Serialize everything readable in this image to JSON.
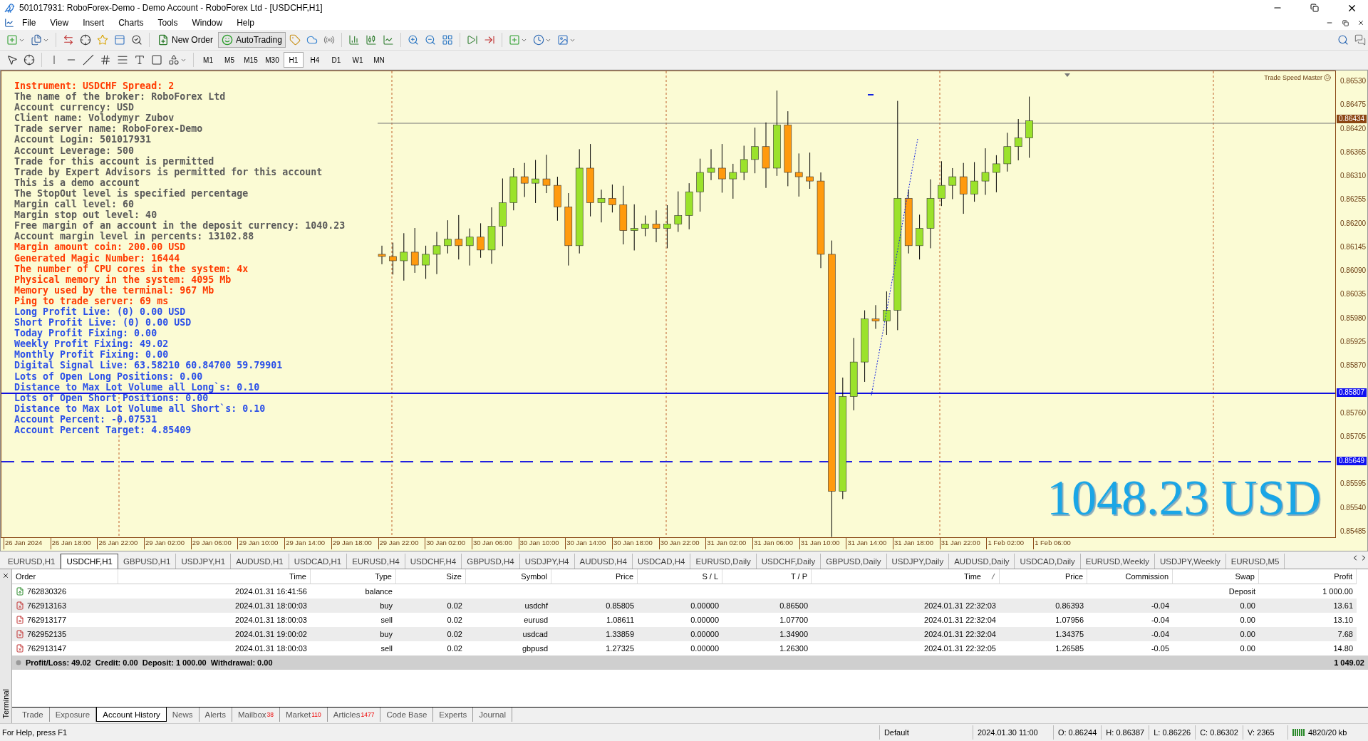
{
  "window": {
    "title": "501017931: RoboForex-Demo - Demo Account - RoboForex Ltd - [USDCHF,H1]"
  },
  "menu": [
    "File",
    "View",
    "Insert",
    "Charts",
    "Tools",
    "Window",
    "Help"
  ],
  "toolbar_buttons": [
    {
      "label": "New Order",
      "on": false
    },
    {
      "label": "AutoTrading",
      "on": true
    }
  ],
  "timeframes": [
    {
      "label": "M1",
      "selected": false
    },
    {
      "label": "M5",
      "selected": false
    },
    {
      "label": "M15",
      "selected": false
    },
    {
      "label": "M30",
      "selected": false
    },
    {
      "label": "H1",
      "selected": true
    },
    {
      "label": "H4",
      "selected": false
    },
    {
      "label": "D1",
      "selected": false
    },
    {
      "label": "W1",
      "selected": false
    },
    {
      "label": "MN",
      "selected": false
    }
  ],
  "chart": {
    "info_lines": [
      {
        "text": "Instrument: USDCHF Spread: 2",
        "kind": "alert"
      },
      {
        "text": "The name of the broker: RoboForex Ltd",
        "kind": "plain"
      },
      {
        "text": "Account currency: USD",
        "kind": "plain"
      },
      {
        "text": "Client name: Volodymyr Zubov",
        "kind": "plain"
      },
      {
        "text": "Trade server name: RoboForex-Demo",
        "kind": "plain"
      },
      {
        "text": "Account Login: 501017931",
        "kind": "plain"
      },
      {
        "text": "Account Leverage: 500",
        "kind": "plain"
      },
      {
        "text": "Trade for this account is permitted",
        "kind": "plain"
      },
      {
        "text": "Trade by Expert Advisors is permitted for this account",
        "kind": "plain"
      },
      {
        "text": "This is a demo account",
        "kind": "plain"
      },
      {
        "text": "The StopOut level is specified percentage",
        "kind": "plain"
      },
      {
        "text": "Margin call level: 60",
        "kind": "plain"
      },
      {
        "text": "Margin stop out level: 40",
        "kind": "plain"
      },
      {
        "text": "Free margin of an account in the deposit currency: 1040.23",
        "kind": "plain"
      },
      {
        "text": "Account margin level in percents: 13102.88",
        "kind": "plain"
      },
      {
        "text": "Margin amount coin: 200.00 USD",
        "kind": "alert"
      },
      {
        "text": "Generated Magic Number: 16444",
        "kind": "alert"
      },
      {
        "text": "The number of CPU cores in the system: 4x",
        "kind": "alert"
      },
      {
        "text": "Physical memory in the system: 4095 Mb",
        "kind": "alert"
      },
      {
        "text": "Memory used by the terminal: 967 Mb",
        "kind": "alert"
      },
      {
        "text": "Ping to trade server: 69 ms",
        "kind": "alert"
      },
      {
        "text": "Long Profit Live: (0) 0.00 USD",
        "kind": "live"
      },
      {
        "text": "Short Profit Live: (0) 0.00 USD",
        "kind": "live"
      },
      {
        "text": "Today Profit Fixing: 0.00",
        "kind": "live"
      },
      {
        "text": "Weekly Profit Fixing: 49.02",
        "kind": "live"
      },
      {
        "text": "Monthly Profit Fixing: 0.00",
        "kind": "live"
      },
      {
        "text": "Digital Signal Live: 63.58210 60.84700 59.79901",
        "kind": "live"
      },
      {
        "text": "Lots of Open Long Positions: 0.00",
        "kind": "live"
      },
      {
        "text": "Distance to Max Lot Volume all Long`s: 0.10",
        "kind": "live"
      },
      {
        "text": "Lots of Open Short Positions: 0.00",
        "kind": "live"
      },
      {
        "text": "Distance to Max Lot Volume all Short`s: 0.10",
        "kind": "live"
      },
      {
        "text": "Account Percent: -0.07531",
        "kind": "live"
      },
      {
        "text": "Account Percent Target: 4.85409",
        "kind": "live"
      }
    ],
    "indicator_label": "Trade Speed Master",
    "price_axis": [
      "0.86530",
      "0.86475",
      "0.86420",
      "0.86365",
      "0.86310",
      "0.86255",
      "0.86200",
      "0.86145",
      "0.86090",
      "0.86035",
      "0.85980",
      "0.85925",
      "0.85870",
      "0.85760",
      "0.85705",
      "0.85595",
      "0.85540",
      "0.85485"
    ],
    "price_tags": [
      {
        "label": "0.86434",
        "kind": "bid"
      },
      {
        "label": "0.85807",
        "kind": "solid"
      },
      {
        "label": "0.85649",
        "kind": "dashed"
      }
    ],
    "time_axis": [
      "26 Jan 2024",
      "26 Jan 18:00",
      "26 Jan 22:00",
      "29 Jan 02:00",
      "29 Jan 06:00",
      "29 Jan 10:00",
      "29 Jan 14:00",
      "29 Jan 18:00",
      "29 Jan 22:00",
      "30 Jan 02:00",
      "30 Jan 06:00",
      "30 Jan 10:00",
      "30 Jan 14:00",
      "30 Jan 18:00",
      "30 Jan 22:00",
      "31 Jan 02:00",
      "31 Jan 06:00",
      "31 Jan 10:00",
      "31 Jan 14:00",
      "31 Jan 18:00",
      "31 Jan 22:00",
      "1 Feb 02:00",
      "1 Feb 06:00"
    ],
    "balance_display": "1048.23 USD"
  },
  "chart_tabs": [
    {
      "label": "EURUSD,H1",
      "selected": false
    },
    {
      "label": "USDCHF,H1",
      "selected": true
    },
    {
      "label": "GBPUSD,H1",
      "selected": false
    },
    {
      "label": "USDJPY,H1",
      "selected": false
    },
    {
      "label": "AUDUSD,H1",
      "selected": false
    },
    {
      "label": "USDCAD,H1",
      "selected": false
    },
    {
      "label": "EURUSD,H4",
      "selected": false
    },
    {
      "label": "USDCHF,H4",
      "selected": false
    },
    {
      "label": "GBPUSD,H4",
      "selected": false
    },
    {
      "label": "USDJPY,H4",
      "selected": false
    },
    {
      "label": "AUDUSD,H4",
      "selected": false
    },
    {
      "label": "USDCAD,H4",
      "selected": false
    },
    {
      "label": "EURUSD,Daily",
      "selected": false
    },
    {
      "label": "USDCHF,Daily",
      "selected": false
    },
    {
      "label": "GBPUSD,Daily",
      "selected": false
    },
    {
      "label": "USDJPY,Daily",
      "selected": false
    },
    {
      "label": "AUDUSD,Daily",
      "selected": false
    },
    {
      "label": "USDCAD,Daily",
      "selected": false
    },
    {
      "label": "EURUSD,Weekly",
      "selected": false
    },
    {
      "label": "USDJPY,Weekly",
      "selected": false
    },
    {
      "label": "EURUSD,M5",
      "selected": false
    }
  ],
  "terminal": {
    "title": "Terminal",
    "columns": [
      "Order",
      "Time",
      "Type",
      "Size",
      "Symbol",
      "Price",
      "S / L",
      "T / P",
      "Time",
      "Price",
      "Commission",
      "Swap",
      "Profit"
    ],
    "rows": [
      {
        "kind": "balance",
        "order": "762830326",
        "time": "2024.01.31 16:41:56",
        "type": "balance",
        "comment": "Deposit",
        "profit": "1 000.00"
      },
      {
        "kind": "trade",
        "order": "762913163",
        "time": "2024.01.31 18:00:03",
        "type": "buy",
        "size": "0.02",
        "symbol": "usdchf",
        "price": "0.85805",
        "sl": "0.00000",
        "tp": "0.86500",
        "close_time": "2024.01.31 22:32:03",
        "close_price": "0.86393",
        "commission": "-0.04",
        "swap": "0.00",
        "profit": "13.61"
      },
      {
        "kind": "trade",
        "order": "762913177",
        "time": "2024.01.31 18:00:03",
        "type": "sell",
        "size": "0.02",
        "symbol": "eurusd",
        "price": "1.08611",
        "sl": "0.00000",
        "tp": "1.07700",
        "close_time": "2024.01.31 22:32:04",
        "close_price": "1.07956",
        "commission": "-0.04",
        "swap": "0.00",
        "profit": "13.10"
      },
      {
        "kind": "trade",
        "order": "762952135",
        "time": "2024.01.31 19:00:02",
        "type": "buy",
        "size": "0.02",
        "symbol": "usdcad",
        "price": "1.33859",
        "sl": "0.00000",
        "tp": "1.34900",
        "close_time": "2024.01.31 22:32:04",
        "close_price": "1.34375",
        "commission": "-0.04",
        "swap": "0.00",
        "profit": "7.68"
      },
      {
        "kind": "trade",
        "order": "762913147",
        "time": "2024.01.31 18:00:03",
        "type": "sell",
        "size": "0.02",
        "symbol": "gbpusd",
        "price": "1.27325",
        "sl": "0.00000",
        "tp": "1.26300",
        "close_time": "2024.01.31 22:32:05",
        "close_price": "1.26585",
        "commission": "-0.05",
        "swap": "0.00",
        "profit": "14.80"
      }
    ],
    "summary": {
      "text": "Profit/Loss: 49.02  Credit: 0.00  Deposit: 1 000.00  Withdrawal: 0.00",
      "total": "1 049.02"
    },
    "tabs": [
      {
        "label": "Trade",
        "selected": false
      },
      {
        "label": "Exposure",
        "selected": false
      },
      {
        "label": "Account History",
        "selected": true
      },
      {
        "label": "News",
        "selected": false
      },
      {
        "label": "Alerts",
        "selected": false
      },
      {
        "label": "Mailbox",
        "badge": "38",
        "selected": false
      },
      {
        "label": "Market",
        "badge": "110",
        "selected": false
      },
      {
        "label": "Articles",
        "badge": "1477",
        "selected": false
      },
      {
        "label": "Code Base",
        "selected": false
      },
      {
        "label": "Experts",
        "selected": false
      },
      {
        "label": "Journal",
        "selected": false
      }
    ]
  },
  "status_bar": {
    "help": "For Help, press F1",
    "profile": "Default",
    "datetime": "2024.01.30 11:00",
    "open": "O: 0.86244",
    "high": "H: 0.86387",
    "low": "L: 0.86226",
    "close": "C: 0.86302",
    "volume": "V: 2365",
    "traffic": "4820/20 kb"
  }
}
